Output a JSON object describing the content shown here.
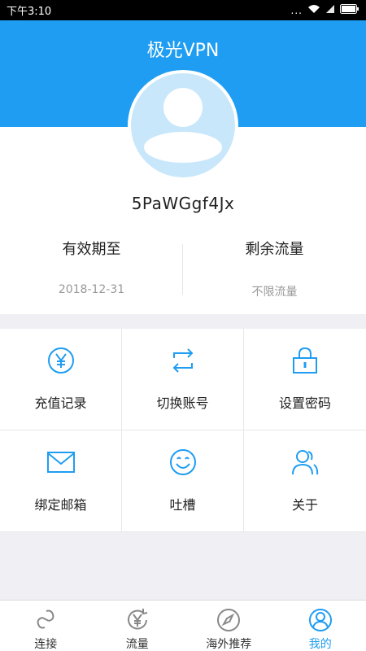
{
  "status": {
    "time": "下午3:10",
    "dots": "..."
  },
  "header": {
    "title": "极光VPN"
  },
  "profile": {
    "username": "5PaWGgf4Jx",
    "expiry_label": "有效期至",
    "expiry_value": "2018-12-31",
    "traffic_label": "剩余流量",
    "traffic_value": "不限流量"
  },
  "menu": [
    {
      "label": "充值记录",
      "icon": "yen-circle-icon"
    },
    {
      "label": "切换账号",
      "icon": "swap-icon"
    },
    {
      "label": "设置密码",
      "icon": "lock-icon"
    },
    {
      "label": "绑定邮箱",
      "icon": "envelope-icon"
    },
    {
      "label": "吐槽",
      "icon": "smile-icon"
    },
    {
      "label": "关于",
      "icon": "people-icon"
    }
  ],
  "tabs": [
    {
      "label": "连接",
      "icon": "link-icon"
    },
    {
      "label": "流量",
      "icon": "yen-refresh-icon"
    },
    {
      "label": "海外推荐",
      "icon": "compass-icon"
    },
    {
      "label": "我的",
      "icon": "user-icon",
      "active": true
    }
  ],
  "colors": {
    "accent": "#1e9df2",
    "icon_gray": "#888888"
  }
}
